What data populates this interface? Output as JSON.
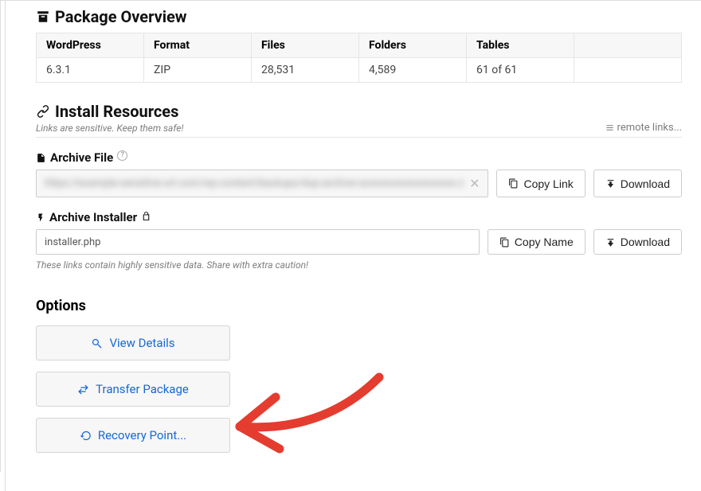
{
  "overview": {
    "title": "Package Overview",
    "columns": [
      "WordPress",
      "Format",
      "Files",
      "Folders",
      "Tables"
    ],
    "values": [
      "6.3.1",
      "ZIP",
      "28,531",
      "4,589",
      "61 of 61"
    ]
  },
  "install": {
    "title": "Install Resources",
    "note": "Links are sensitive. Keep them safe!",
    "remote_label": "remote links...",
    "archive_file_label": "Archive File",
    "archive_file_value": "https://example-sensitive-url.com/wp-content/backups/dup-archive-xxxxxxxxxxxxxxxxxxx.zip",
    "archive_installer_label": "Archive Installer",
    "archive_installer_value": "installer.php",
    "copy_link_label": "Copy Link",
    "copy_name_label": "Copy Name",
    "download_label": "Download",
    "caution": "These links contain highly sensitive data. Share with extra caution!"
  },
  "options": {
    "title": "Options",
    "view_details": "View Details",
    "transfer_package": "Transfer Package",
    "recovery_point": "Recovery Point..."
  }
}
